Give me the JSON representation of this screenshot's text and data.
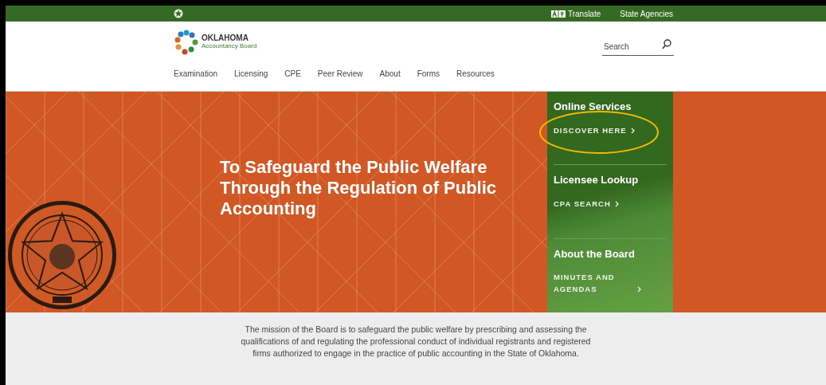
{
  "top_bar": {
    "translate": "Translate",
    "agencies": "State Agencies"
  },
  "logo": {
    "title": "OKLAHOMA",
    "subtitle": "Accountancy Board"
  },
  "search": {
    "placeholder": "Search"
  },
  "nav": [
    "Examination",
    "Licensing",
    "CPE",
    "Peer Review",
    "About",
    "Forms",
    "Resources"
  ],
  "hero": {
    "headline": "To Safeguard the Public Welfare Through the Regulation of Public Accounting"
  },
  "services": [
    {
      "title": "Online Services",
      "link": "DISCOVER HERE",
      "highlighted": true
    },
    {
      "title": "Licensee Lookup",
      "link": "CPA SEARCH",
      "highlighted": false
    },
    {
      "title": "About the Board",
      "link": "MINUTES AND AGENDAS",
      "highlighted": false
    }
  ],
  "mission": "The mission of the Board is to safeguard the public welfare by prescribing and assessing the qualifications of and regulating the professional conduct of individual registrants and registered firms authorized to engage in the practice of public accounting in the State of Oklahoma."
}
